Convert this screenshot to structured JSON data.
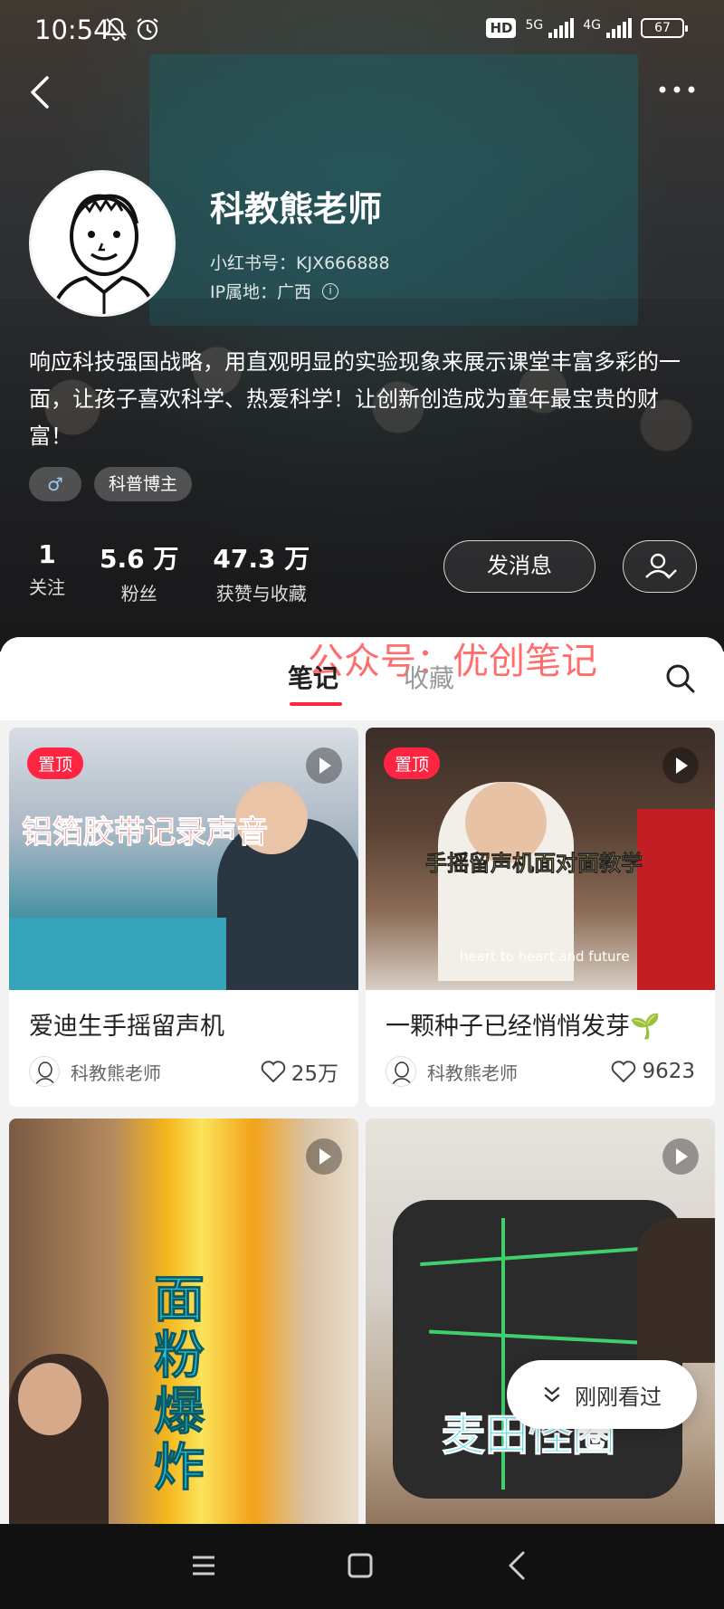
{
  "status_bar": {
    "time": "10:54",
    "hd_label": "HD",
    "net1": "5G",
    "net2": "4G",
    "battery": "67"
  },
  "profile": {
    "name": "科教熊老师",
    "red_id": "小红书号：KJX666888",
    "ip": "IP属地：广西",
    "bio": "响应科技强国战略，用直观明显的实验现象来展示课堂丰富多彩的一面，让孩子喜欢科学、热爱科学！让创新创造成为童年最宝贵的财富！",
    "gender_symbol": "♂",
    "tag": "科普博主",
    "stats": [
      {
        "num": "1",
        "label": "关注"
      },
      {
        "num": "5.6 万",
        "label": "粉丝"
      },
      {
        "num": "47.3 万",
        "label": "获赞与收藏"
      }
    ],
    "message_button": "发消息"
  },
  "tabs": {
    "notes": "笔记",
    "collections": "收藏",
    "watermark": "公众号：优创笔记"
  },
  "cards": [
    {
      "pin": "置顶",
      "overlay": "铝箔胶带记录声音",
      "title": "爱迪生手摇留声机",
      "author": "科教熊老师",
      "likes": "25万"
    },
    {
      "pin": "置顶",
      "overlay": "手摇留声机面对面教学",
      "subcaption": "heart to heart and future",
      "title": "一颗种子已经悄悄发芽🌱",
      "author": "科教熊老师",
      "likes": "9623"
    },
    {
      "overlay": "面粉爆炸"
    },
    {
      "overlay": "麦田怪圈"
    }
  ],
  "float_pill": "刚刚看过",
  "colors": {
    "accent": "#ff2442"
  }
}
